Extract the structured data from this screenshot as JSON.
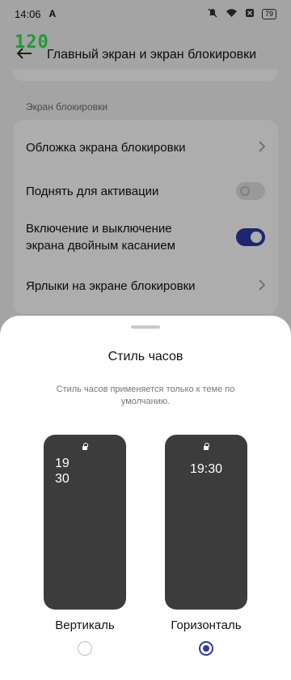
{
  "status_bar": {
    "time": "14:06",
    "notification_icon": "A",
    "battery": "79"
  },
  "overlay_fps": "120",
  "header": {
    "title": "Главный экран и экран блокировки"
  },
  "section_label": "Экран блокировки",
  "settings": [
    {
      "label": "Обложка экрана блокировки",
      "control": "chevron"
    },
    {
      "label": "Поднять для активации",
      "control": "toggle",
      "state": "off"
    },
    {
      "label": "Включение и выключение экрана двойным касанием",
      "control": "toggle",
      "state": "on"
    },
    {
      "label": "Ярлыки на экране блокировки",
      "control": "chevron"
    }
  ],
  "sheet": {
    "title": "Стиль часов",
    "description": "Стиль часов применяется только к теме по умолчанию.",
    "options": [
      {
        "label": "Вертикаль",
        "clock_line1": "19",
        "clock_line2": "30",
        "selected": false
      },
      {
        "label": "Горизонталь",
        "clock": "19:30",
        "selected": true
      }
    ]
  },
  "colors": {
    "accent": "#2b3aa6",
    "fps_overlay": "#2ee64a",
    "phone_preview": "#3c3c3c"
  }
}
